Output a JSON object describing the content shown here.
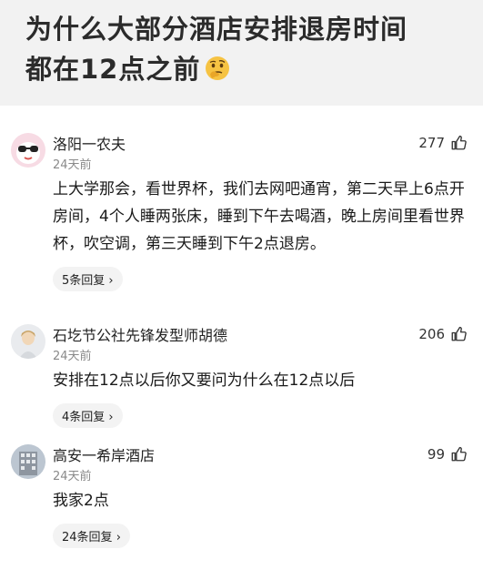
{
  "post": {
    "title_line1": "为什么大部分酒店安排退房时间",
    "title_line2": "都在12点之前"
  },
  "comments": [
    {
      "username": "洛阳一农夫",
      "time": "24天前",
      "likes": "277",
      "content": "上大学那会，看世界杯，我们去网吧通宵，第二天早上6点开房间，4个人睡两张床，睡到下午去喝酒，晚上房间里看世界杯，吹空调，第三天睡到下午2点退房。",
      "replies": "5条回复"
    },
    {
      "username": "石圪节公社先锋发型师胡德",
      "time": "24天前",
      "likes": "206",
      "content": "安排在12点以后你又要问为什么在12点以后",
      "replies": "4条回复"
    },
    {
      "username": "高安一希岸酒店",
      "time": "24天前",
      "likes": "99",
      "content": "我家2点",
      "replies": "24条回复"
    }
  ],
  "icons": {
    "title_emoji": "thinking-face-icon",
    "like": "thumbs-up-icon",
    "reply_arrow": "chevron-right-icon"
  }
}
